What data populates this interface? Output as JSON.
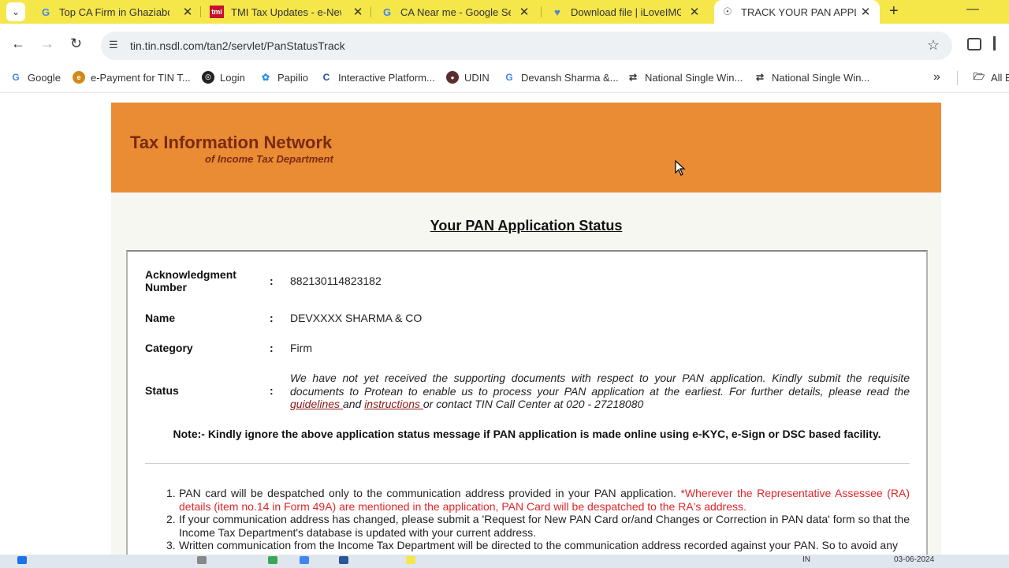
{
  "browser": {
    "tabs": [
      {
        "title": "Top CA Firm in Ghaziabd",
        "favicon": "google-icon"
      },
      {
        "title": "TMI Tax Updates - e-New",
        "favicon": "tmi-icon",
        "favicon_text": "tmi"
      },
      {
        "title": "CA Near me - Google Se",
        "favicon": "google-icon"
      },
      {
        "title": "Download file | iLoveIMG",
        "favicon": "heart-icon"
      },
      {
        "title": "TRACK YOUR PAN APPLIC",
        "favicon": "globe-icon",
        "active": true
      }
    ],
    "url": "tin.tin.nsdl.com/tan2/servlet/PanStatusTrack",
    "bookmarks": [
      {
        "label": "Google",
        "icon": "google-icon"
      },
      {
        "label": "e-Payment for TIN T...",
        "icon": "epayment-icon"
      },
      {
        "label": "Login",
        "icon": "globe-icon"
      },
      {
        "label": "Papilio",
        "icon": "papilio-icon"
      },
      {
        "label": "Interactive Platform...",
        "icon": "c-icon"
      },
      {
        "label": "UDIN",
        "icon": "udin-icon"
      },
      {
        "label": "Devansh Sharma &...",
        "icon": "google-icon"
      },
      {
        "label": "National Single Win...",
        "icon": "link-icon"
      },
      {
        "label": "National Single Win...",
        "icon": "link-icon"
      }
    ],
    "all_bookmarks_label": "All B"
  },
  "page": {
    "banner_title": "Tax Information Network",
    "banner_subtitle": "of Income Tax Department",
    "heading": "Your PAN Application Status",
    "fields": {
      "ack_label": "Acknowledgment Number",
      "ack_value": "882130114823182",
      "name_label": "Name",
      "name_value": "DEVXXXX SHARMA & CO",
      "category_label": "Category",
      "category_value": "Firm",
      "status_label": "Status",
      "colon": ":",
      "status_text_1": "We have not yet received the supporting documents with respect to your PAN application. Kindly submit the requisite documents to Protean to enable us to process your PAN application at the earliest. For further details, please read the ",
      "status_link_1": "guidelines ",
      "status_text_2": "and ",
      "status_link_2": "instructions ",
      "status_text_3": "or contact TIN Call Center at 020 - 27218080"
    },
    "note": "Note:- Kindly ignore the above application status message if PAN application is made online using e-KYC, e-Sign or DSC based facility.",
    "list": [
      {
        "num": "1.",
        "text": "PAN card will be despatched only to the communication address provided in your PAN application. ",
        "red": "*Wherever the Representative Assessee (RA) details (item no.14 in Form 49A) are mentioned in the application, PAN Card will be despatched to the RA's address."
      },
      {
        "num": "2.",
        "text": "If your communication address has changed, please submit a 'Request for New PAN Card or/and Changes or Correction in PAN data' form so that the Income Tax Department's database is updated with your current address."
      },
      {
        "num": "3.",
        "text": "Written communication from the Income Tax Department will be directed to the communication address recorded against your PAN. So to avoid any"
      }
    ]
  },
  "taskbar": {
    "lang": "IN",
    "date": "03-06-2024"
  },
  "colors": {
    "tabstrip": "#f5e64a",
    "banner": "#e98c34",
    "banner_text": "#7a2a12",
    "red_text": "#e0262a"
  }
}
